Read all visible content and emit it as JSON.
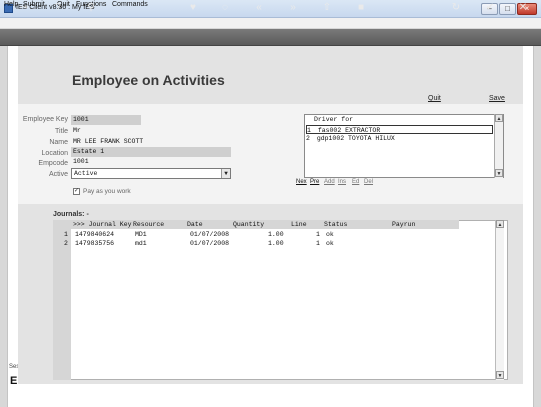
{
  "window": {
    "title": "IES Client v8.36 : My IES",
    "minimize_glyph": "–",
    "maximize_glyph": "□",
    "close_glyph": "×"
  },
  "menu": [
    "Help",
    "Submit",
    "Quit",
    "Functions",
    "Commands"
  ],
  "toolbar": {
    "icons": [
      "key-icon",
      "help-icon",
      "search-icon",
      "heart-icon",
      "history-icon",
      "rewind-icon",
      "fast-forward-icon",
      "upload-icon",
      "stop-icon",
      "refresh-icon",
      "confirm-icon",
      "close-icon"
    ],
    "glyphs": [
      "⊸",
      "?",
      "⚲",
      "♥",
      "◌",
      "«",
      "»",
      "⇧",
      "■",
      "↻",
      "✔",
      "✕"
    ]
  },
  "side": {
    "session_text": "Ses",
    "session_letter": "E"
  },
  "page": {
    "title": "Employee on Activities",
    "quit_label": "Quit",
    "save_label": "Save"
  },
  "form": {
    "employee_key": {
      "label": "Employee Key",
      "value": "1001"
    },
    "title": {
      "label": "Title",
      "value": "Mr"
    },
    "name": {
      "label": "Name",
      "value": "MR LEE FRANK SCOTT"
    },
    "location": {
      "label": "Location",
      "value": "Estate 1"
    },
    "empcode": {
      "label": "Empcode",
      "value": "1001"
    },
    "active": {
      "label": "Active",
      "value": "Active"
    },
    "pay_as_you_work": {
      "label": "Pay as you work",
      "checked": true,
      "glyph": "✓"
    }
  },
  "driver": {
    "header": "Driver for",
    "rows": [
      {
        "num": "1",
        "text": "fas002 EXTRACTOR"
      },
      {
        "num": "2",
        "text": "gdp1002 TOYOTA HILUX"
      }
    ],
    "nav": [
      "Nex",
      "Pre",
      "Add",
      "Ins",
      "Ed",
      "Del"
    ]
  },
  "journals": {
    "label": "Journals: -",
    "columns": [
      ">>> Journal Key",
      "Resource",
      "Date",
      "Quantity",
      "Line",
      "Status",
      "Payrun"
    ],
    "rows": [
      {
        "num": "1",
        "journal_key": "1479840624",
        "resource": "MD1",
        "date": "01/07/2008",
        "quantity": "1.00",
        "line": "1",
        "status": "ok",
        "payrun": ""
      },
      {
        "num": "2",
        "journal_key": "1479835756",
        "resource": "md1",
        "date": "01/07/2008",
        "quantity": "1.00",
        "line": "1",
        "status": "ok",
        "payrun": ""
      }
    ]
  },
  "scroll": {
    "up_glyph": "▲",
    "down_glyph": "▼"
  }
}
